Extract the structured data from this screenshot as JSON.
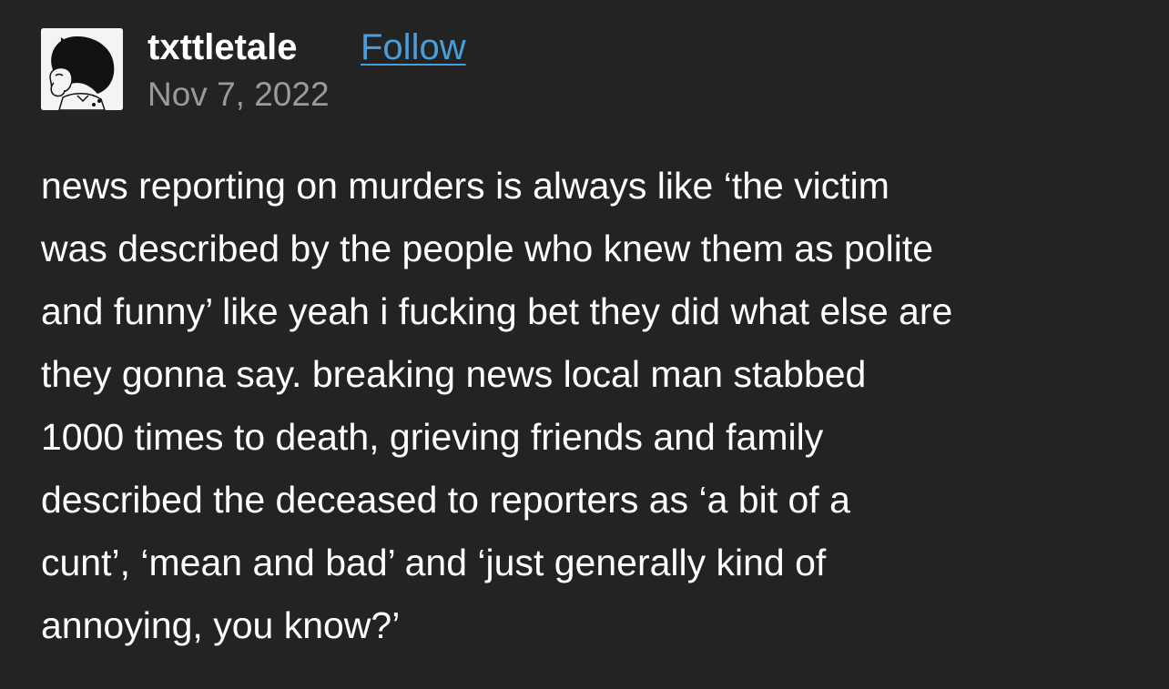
{
  "post": {
    "author": "txttletale",
    "follow_label": "Follow",
    "date": "Nov 7, 2022",
    "body_lines": [
      "news reporting on murders is always like ‘the victim",
      "was described by the people who knew them as polite",
      "and funny’ like yeah i fucking bet they did what else are",
      "they gonna say. breaking news local man stabbed",
      "1000 times to death, grieving friends and family",
      "described the deceased to reporters as ‘a bit of a",
      "cunt’, ‘mean and bad’ and ‘just generally kind of",
      "annoying, you know?’"
    ]
  },
  "colors": {
    "background": "#232323",
    "text": "#ffffff",
    "link": "#4b9dd8",
    "muted": "#9a9a9a"
  }
}
